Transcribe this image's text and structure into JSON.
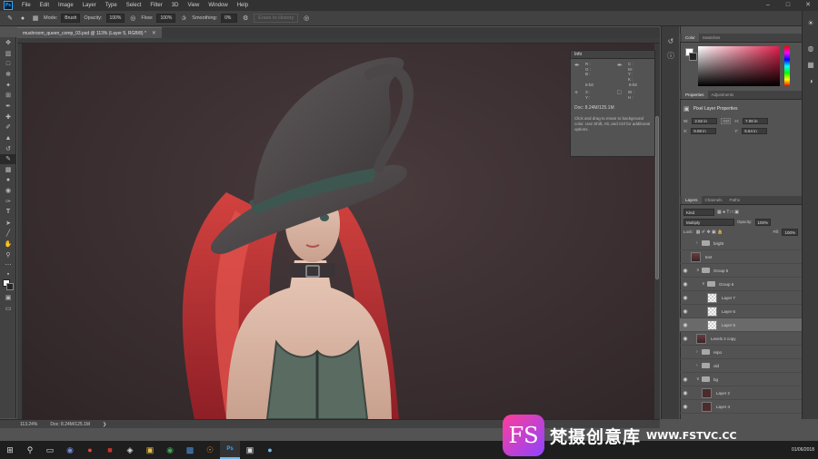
{
  "app": {
    "logo": "Ps"
  },
  "menu": [
    "File",
    "Edit",
    "Image",
    "Layer",
    "Type",
    "Select",
    "Filter",
    "3D",
    "View",
    "Window",
    "Help"
  ],
  "options": {
    "mode_label": "Mode:",
    "mode_value": "Brush",
    "opacity_label": "Opacity:",
    "opacity_value": "100%",
    "flow_label": "Flow:",
    "flow_value": "100%",
    "smoothing_label": "Smoothing:",
    "smoothing_value": "0%",
    "erase_history": "Erase to History"
  },
  "document": {
    "tab_title": "mushroom_queen_comp_03.psd @ 113% (Layer 5, RGB/8) *",
    "zoom": "113.24%",
    "doc_size": "Doc: 8.24M/125.1M"
  },
  "info_panel": {
    "title": "Info",
    "rgb_labels": [
      "R :",
      "G :",
      "B :"
    ],
    "cmyk_labels": [
      "C :",
      "M :",
      "Y :",
      "K :"
    ],
    "depth_left": "8-bit",
    "depth_right": "8-bit",
    "xy_labels": [
      "X :",
      "Y :"
    ],
    "wh_labels": [
      "W :",
      "H :"
    ],
    "doc": "Doc: 8.24M/125.1M",
    "help": "Click and drag to erase to background color. Use Shift, Alt, and Ctrl for additional options."
  },
  "color_panel": {
    "tabs": [
      "Color",
      "Swatches"
    ]
  },
  "properties": {
    "tabs": [
      "Properties",
      "Adjustments"
    ],
    "heading": "Pixel Layer Properties",
    "w_label": "W:",
    "w": "2.82 in",
    "h_label": "H:",
    "h": "7.08 in",
    "x_label": "X:",
    "x": "9.58 in",
    "y_label": "Y:",
    "y": "5.64 in",
    "link": "GO"
  },
  "layers_panel": {
    "tabs": [
      "Layers",
      "Channels",
      "Paths"
    ],
    "kind": "Kind",
    "blend": "Multiply",
    "opacity_label": "Opacity:",
    "opacity": "100%",
    "lock_label": "Lock:",
    "fill_label": "Fill:",
    "fill": "100%",
    "layers": [
      {
        "name": "bright",
        "type": "folder",
        "visible": false,
        "indent": 1
      },
      {
        "name": "text",
        "type": "fig",
        "visible": false,
        "indent": 0
      },
      {
        "name": "Group 5",
        "type": "folder",
        "visible": true,
        "indent": 1,
        "open": true
      },
      {
        "name": "Group 6",
        "type": "folder",
        "visible": true,
        "indent": 2,
        "open": true
      },
      {
        "name": "Layer 7",
        "type": "trans",
        "visible": true,
        "indent": 3
      },
      {
        "name": "Layer 6",
        "type": "trans",
        "visible": true,
        "indent": 3
      },
      {
        "name": "Layer 5",
        "type": "trans",
        "visible": true,
        "indent": 3,
        "selected": true
      },
      {
        "name": "Levels 2 copy",
        "type": "fig",
        "visible": true,
        "indent": 1
      },
      {
        "name": "repo",
        "type": "folder",
        "visible": false,
        "indent": 1
      },
      {
        "name": "old",
        "type": "folder",
        "visible": false,
        "indent": 1
      },
      {
        "name": "bg",
        "type": "folder",
        "visible": true,
        "indent": 1,
        "open": true
      },
      {
        "name": "Layer 2",
        "type": "dark",
        "visible": true,
        "indent": 2
      },
      {
        "name": "Layer 4",
        "type": "dark",
        "visible": true,
        "indent": 2
      }
    ]
  },
  "taskbar": {
    "date": "01/06/2018"
  },
  "watermark": {
    "logo": "FS",
    "cn": "梵摄创意库",
    "url": "WWW.FSTVC.CC"
  },
  "colors": {
    "accent": "#31a8ff",
    "canvas_bg": "#3a2e30",
    "hair": "#c0303a",
    "dress": "#5a6b62"
  }
}
